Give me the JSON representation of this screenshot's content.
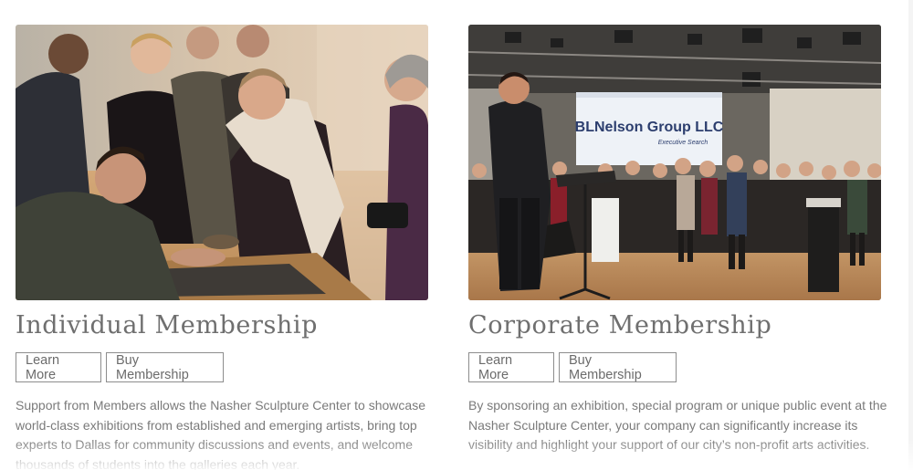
{
  "individual": {
    "title": "Individual Membership",
    "learn_more_label": "Learn More",
    "buy_label": "Buy Membership",
    "description": "Support from Members allows the Nasher Sculpture Center to showcase world-class exhibitions from established and emerging artists, bring top experts to Dallas for community discussions and events, and welcome thousands of students into the galleries each year."
  },
  "corporate": {
    "title": "Corporate Membership",
    "learn_more_label": "Learn More",
    "buy_label": "Buy Membership",
    "description": "By sponsoring an exhibition, special program or unique public event at the Nasher Sculpture Center, your company can significantly increase its visibility and highlight your support of our city’s non-profit arts activities.",
    "screen_sign_line1": "BLNelson Group LLC",
    "screen_sign_line2": "Executive Search"
  },
  "colors": {
    "text": "#6f6f6f",
    "button_border": "#8d8d8d",
    "background": "#ffffff"
  }
}
